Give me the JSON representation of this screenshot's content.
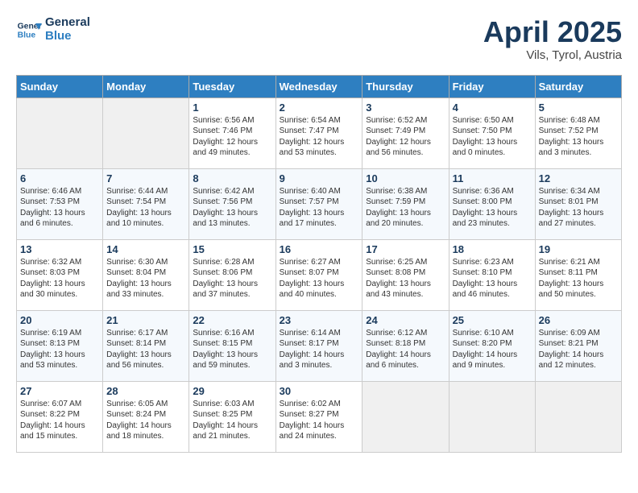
{
  "logo": {
    "line1": "General",
    "line2": "Blue"
  },
  "title": "April 2025",
  "subtitle": "Vils, Tyrol, Austria",
  "header_days": [
    "Sunday",
    "Monday",
    "Tuesday",
    "Wednesday",
    "Thursday",
    "Friday",
    "Saturday"
  ],
  "weeks": [
    [
      {
        "day": "",
        "info": ""
      },
      {
        "day": "",
        "info": ""
      },
      {
        "day": "1",
        "info": "Sunrise: 6:56 AM\nSunset: 7:46 PM\nDaylight: 12 hours and 49 minutes."
      },
      {
        "day": "2",
        "info": "Sunrise: 6:54 AM\nSunset: 7:47 PM\nDaylight: 12 hours and 53 minutes."
      },
      {
        "day": "3",
        "info": "Sunrise: 6:52 AM\nSunset: 7:49 PM\nDaylight: 12 hours and 56 minutes."
      },
      {
        "day": "4",
        "info": "Sunrise: 6:50 AM\nSunset: 7:50 PM\nDaylight: 13 hours and 0 minutes."
      },
      {
        "day": "5",
        "info": "Sunrise: 6:48 AM\nSunset: 7:52 PM\nDaylight: 13 hours and 3 minutes."
      }
    ],
    [
      {
        "day": "6",
        "info": "Sunrise: 6:46 AM\nSunset: 7:53 PM\nDaylight: 13 hours and 6 minutes."
      },
      {
        "day": "7",
        "info": "Sunrise: 6:44 AM\nSunset: 7:54 PM\nDaylight: 13 hours and 10 minutes."
      },
      {
        "day": "8",
        "info": "Sunrise: 6:42 AM\nSunset: 7:56 PM\nDaylight: 13 hours and 13 minutes."
      },
      {
        "day": "9",
        "info": "Sunrise: 6:40 AM\nSunset: 7:57 PM\nDaylight: 13 hours and 17 minutes."
      },
      {
        "day": "10",
        "info": "Sunrise: 6:38 AM\nSunset: 7:59 PM\nDaylight: 13 hours and 20 minutes."
      },
      {
        "day": "11",
        "info": "Sunrise: 6:36 AM\nSunset: 8:00 PM\nDaylight: 13 hours and 23 minutes."
      },
      {
        "day": "12",
        "info": "Sunrise: 6:34 AM\nSunset: 8:01 PM\nDaylight: 13 hours and 27 minutes."
      }
    ],
    [
      {
        "day": "13",
        "info": "Sunrise: 6:32 AM\nSunset: 8:03 PM\nDaylight: 13 hours and 30 minutes."
      },
      {
        "day": "14",
        "info": "Sunrise: 6:30 AM\nSunset: 8:04 PM\nDaylight: 13 hours and 33 minutes."
      },
      {
        "day": "15",
        "info": "Sunrise: 6:28 AM\nSunset: 8:06 PM\nDaylight: 13 hours and 37 minutes."
      },
      {
        "day": "16",
        "info": "Sunrise: 6:27 AM\nSunset: 8:07 PM\nDaylight: 13 hours and 40 minutes."
      },
      {
        "day": "17",
        "info": "Sunrise: 6:25 AM\nSunset: 8:08 PM\nDaylight: 13 hours and 43 minutes."
      },
      {
        "day": "18",
        "info": "Sunrise: 6:23 AM\nSunset: 8:10 PM\nDaylight: 13 hours and 46 minutes."
      },
      {
        "day": "19",
        "info": "Sunrise: 6:21 AM\nSunset: 8:11 PM\nDaylight: 13 hours and 50 minutes."
      }
    ],
    [
      {
        "day": "20",
        "info": "Sunrise: 6:19 AM\nSunset: 8:13 PM\nDaylight: 13 hours and 53 minutes."
      },
      {
        "day": "21",
        "info": "Sunrise: 6:17 AM\nSunset: 8:14 PM\nDaylight: 13 hours and 56 minutes."
      },
      {
        "day": "22",
        "info": "Sunrise: 6:16 AM\nSunset: 8:15 PM\nDaylight: 13 hours and 59 minutes."
      },
      {
        "day": "23",
        "info": "Sunrise: 6:14 AM\nSunset: 8:17 PM\nDaylight: 14 hours and 3 minutes."
      },
      {
        "day": "24",
        "info": "Sunrise: 6:12 AM\nSunset: 8:18 PM\nDaylight: 14 hours and 6 minutes."
      },
      {
        "day": "25",
        "info": "Sunrise: 6:10 AM\nSunset: 8:20 PM\nDaylight: 14 hours and 9 minutes."
      },
      {
        "day": "26",
        "info": "Sunrise: 6:09 AM\nSunset: 8:21 PM\nDaylight: 14 hours and 12 minutes."
      }
    ],
    [
      {
        "day": "27",
        "info": "Sunrise: 6:07 AM\nSunset: 8:22 PM\nDaylight: 14 hours and 15 minutes."
      },
      {
        "day": "28",
        "info": "Sunrise: 6:05 AM\nSunset: 8:24 PM\nDaylight: 14 hours and 18 minutes."
      },
      {
        "day": "29",
        "info": "Sunrise: 6:03 AM\nSunset: 8:25 PM\nDaylight: 14 hours and 21 minutes."
      },
      {
        "day": "30",
        "info": "Sunrise: 6:02 AM\nSunset: 8:27 PM\nDaylight: 14 hours and 24 minutes."
      },
      {
        "day": "",
        "info": ""
      },
      {
        "day": "",
        "info": ""
      },
      {
        "day": "",
        "info": ""
      }
    ]
  ]
}
